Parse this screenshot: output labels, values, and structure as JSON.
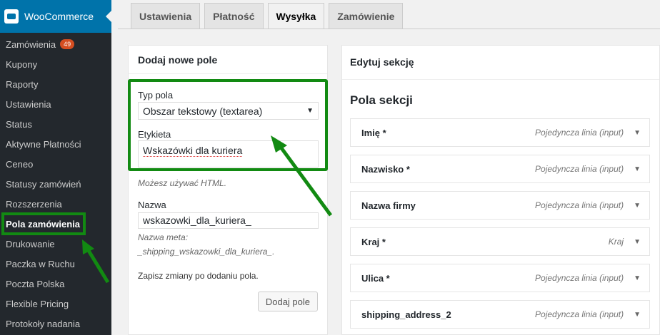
{
  "sidebar": {
    "title": "WooCommerce",
    "items": [
      {
        "label": "Zamówienia",
        "badge": "49"
      },
      {
        "label": "Kupony"
      },
      {
        "label": "Raporty"
      },
      {
        "label": "Ustawienia"
      },
      {
        "label": "Status"
      },
      {
        "label": "Aktywne Płatności"
      },
      {
        "label": "Ceneo"
      },
      {
        "label": "Statusy zamówień"
      },
      {
        "label": "Rozszerzenia"
      },
      {
        "label": "Pola zamówienia"
      },
      {
        "label": "Drukowanie"
      },
      {
        "label": "Paczka w Ruchu"
      },
      {
        "label": "Poczta Polska"
      },
      {
        "label": "Flexible Pricing"
      },
      {
        "label": "Protokoły nadania"
      }
    ]
  },
  "tabs": [
    "Ustawienia",
    "Płatność",
    "Wysyłka",
    "Zamówienie"
  ],
  "add_panel": {
    "title": "Dodaj nowe pole",
    "type_label": "Typ pola",
    "type_value": "Obszar tekstowy (textarea)",
    "label_label": "Etykieta",
    "label_value": "Wskazówki dla kuriera",
    "html_hint": "Możesz używać HTML.",
    "name_label": "Nazwa",
    "name_value": "wskazowki_dla_kuriera_",
    "meta_hint_1": "Nazwa meta:",
    "meta_hint_2": "_shipping_wskazowki_dla_kuriera_.",
    "save_note": "Zapisz zmiany po dodaniu pola.",
    "add_button": "Dodaj pole"
  },
  "edit_panel": {
    "title": "Edytuj sekcję",
    "section_title": "Pola sekcji",
    "fields": [
      {
        "name": "Imię *",
        "type": "Pojedyncza linia (input)"
      },
      {
        "name": "Nazwisko *",
        "type": "Pojedyncza linia (input)"
      },
      {
        "name": "Nazwa firmy",
        "type": "Pojedyncza linia (input)"
      },
      {
        "name": "Kraj *",
        "type": "Kraj"
      },
      {
        "name": "Ulica *",
        "type": "Pojedyncza linia (input)"
      },
      {
        "name": "shipping_address_2",
        "type": "Pojedyncza linia (input)"
      }
    ]
  },
  "colors": {
    "highlight": "#128a12",
    "sidebar": "#23282d",
    "accent": "#0073aa",
    "badge": "#d54e21"
  }
}
